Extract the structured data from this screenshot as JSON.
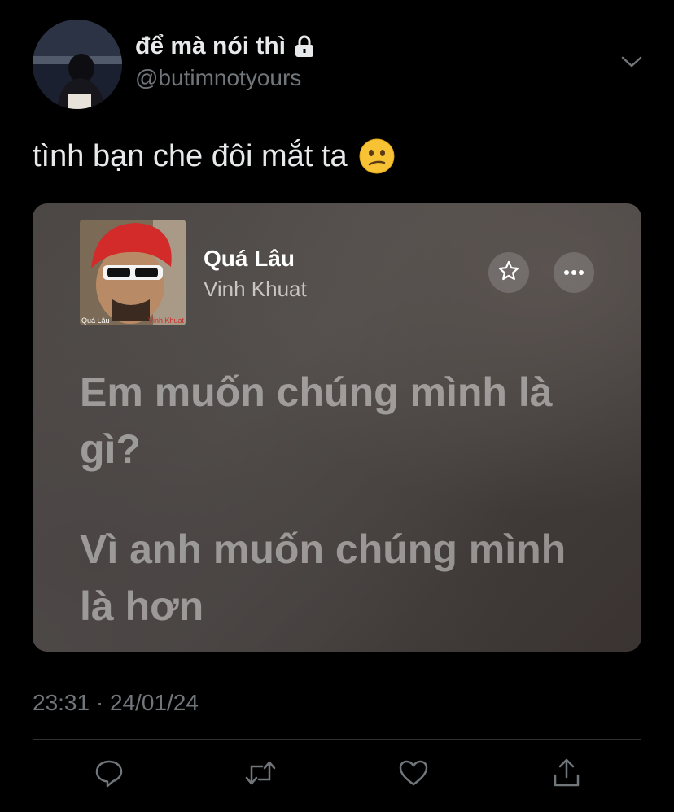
{
  "author": {
    "display_name": "để mà nói thì",
    "handle": "@butimnotyours",
    "avatar_icon": "profile-photo",
    "lock_icon": "lock-icon",
    "menu_icon": "chevron-down-icon"
  },
  "tweet": {
    "text": "tình bạn che đôi mắt ta",
    "emoji_icon": "confused-face-emoji",
    "timestamp": "23:31 · 24/01/24"
  },
  "music_card": {
    "album_art_caption_title": "Quá Lâu",
    "album_art_caption_artist": "Vinh Khuat",
    "song_title": "Quá Lâu",
    "artist": "Vinh Khuat",
    "star_icon": "star-icon",
    "more_icon": "more-options-icon",
    "lyrics": [
      "Em muốn chúng mình là gì?",
      "Vì anh muốn chúng mình là hơn"
    ]
  },
  "actions": [
    {
      "name": "reply",
      "icon": "reply-icon"
    },
    {
      "name": "retweet",
      "icon": "retweet-icon"
    },
    {
      "name": "like",
      "icon": "heart-icon"
    },
    {
      "name": "share",
      "icon": "share-icon"
    }
  ],
  "colors": {
    "background": "#000000",
    "primary_text": "#e7e9ea",
    "secondary_text": "#71767b",
    "divider": "#2f3336",
    "card_background": "#4c4745",
    "lyric_text": "#9a9592"
  }
}
